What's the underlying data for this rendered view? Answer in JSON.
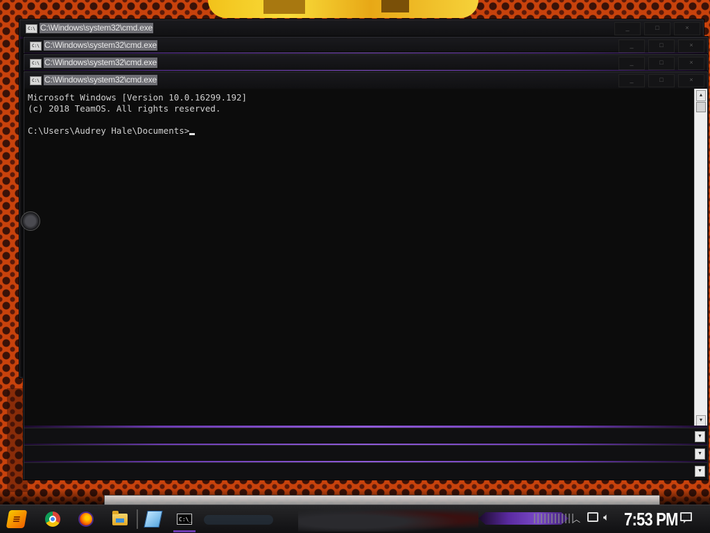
{
  "windows": [
    {
      "title": "C:\\Windows\\system32\\cmd.exe"
    },
    {
      "title": "C:\\Windows\\system32\\cmd.exe"
    },
    {
      "title": "C:\\Windows\\system32\\cmd.exe"
    },
    {
      "title": "C:\\Windows\\system32\\cmd.exe"
    }
  ],
  "window_buttons": {
    "minimize": "_",
    "maximize": "□",
    "close": "×"
  },
  "console": {
    "line1": "Microsoft Windows [Version 10.0.16299.192]",
    "line2": "(c) 2018 TeamOS. All rights reserved.",
    "line3": "",
    "prompt": "C:\\Users\\Audrey Hale\\Documents>"
  },
  "taskbar": {
    "icons": [
      "start-icon",
      "chrome-icon",
      "firefox-icon",
      "file-explorer-icon",
      "sticky-pad-icon",
      "cmd-icon"
    ],
    "clock": "7:53 PM"
  },
  "colors": {
    "console_bg": "#0c0c0c",
    "console_text": "#cfcfcf",
    "accent_purple": "#7a4ac8",
    "wallpaper": "#c8420c"
  }
}
